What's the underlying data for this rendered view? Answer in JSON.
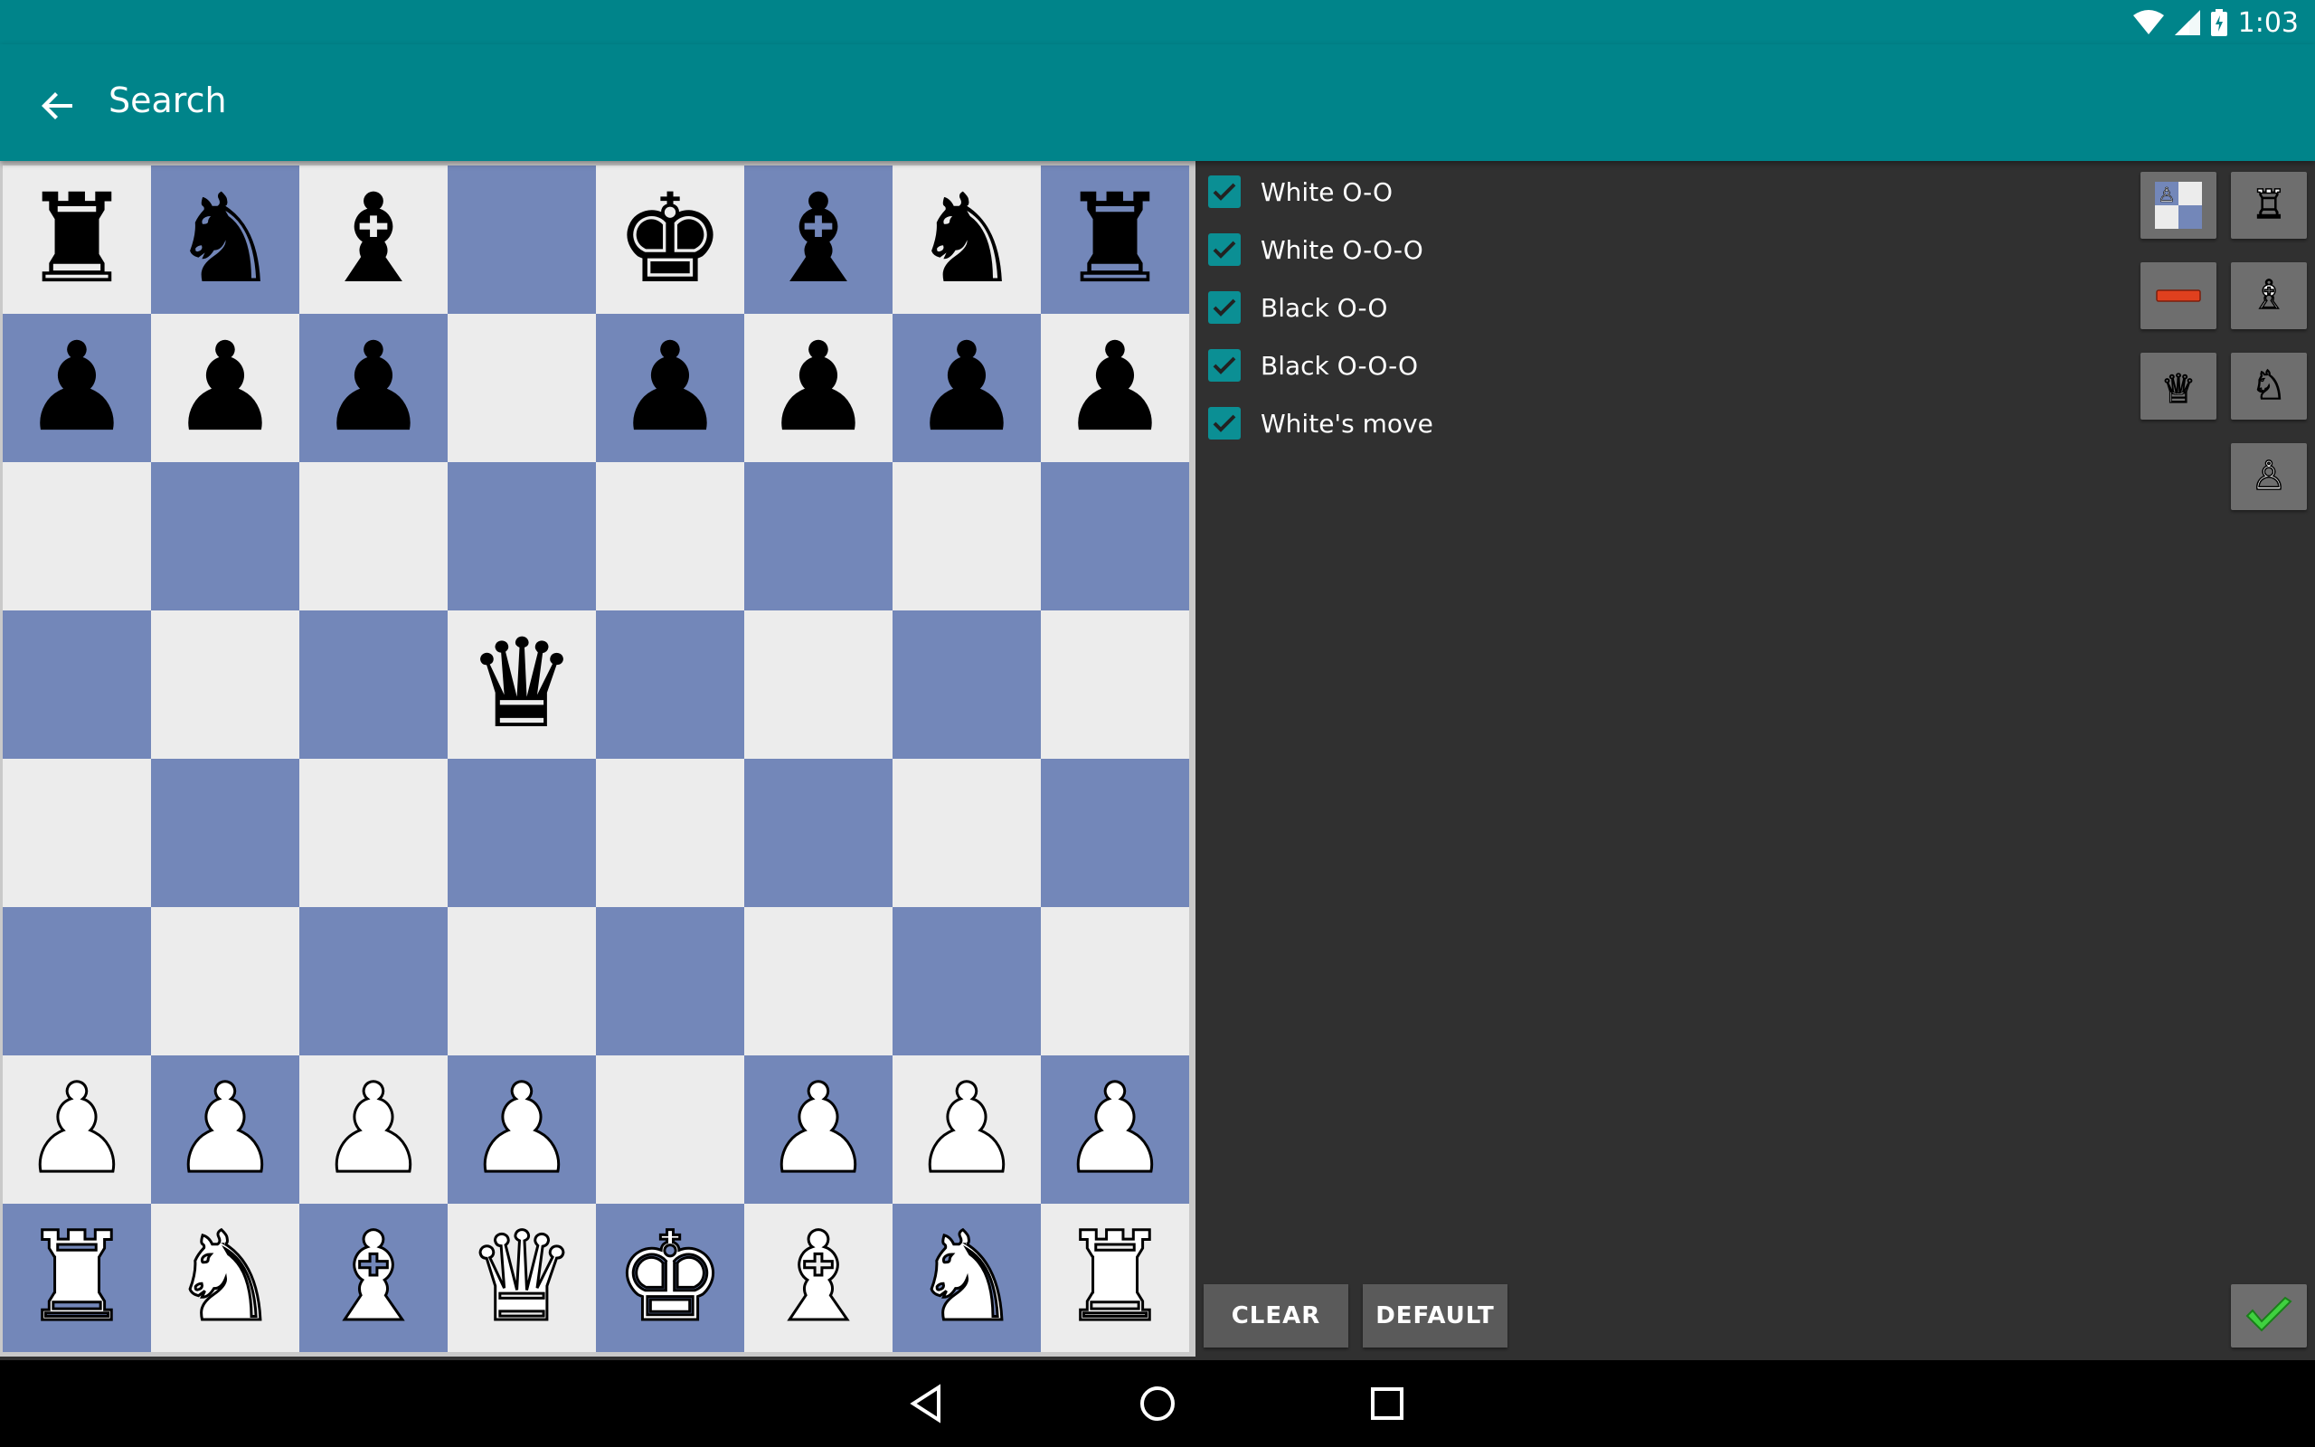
{
  "status_bar": {
    "time": "1:03"
  },
  "app_bar": {
    "title": "Search"
  },
  "board": {
    "rows": [
      [
        "br",
        "bn",
        "bb",
        "",
        "bk",
        "bb",
        "bn",
        "br"
      ],
      [
        "bp",
        "bp",
        "bp",
        "",
        "bp",
        "bp",
        "bp",
        "bp"
      ],
      [
        "",
        "",
        "",
        "",
        "",
        "",
        "",
        ""
      ],
      [
        "",
        "",
        "",
        "bq",
        "",
        "",
        "",
        ""
      ],
      [
        "",
        "",
        "",
        "",
        "",
        "",
        "",
        ""
      ],
      [
        "",
        "",
        "",
        "",
        "",
        "",
        "",
        ""
      ],
      [
        "wp",
        "wp",
        "wp",
        "wp",
        "",
        "wp",
        "wp",
        "wp"
      ],
      [
        "wr",
        "wn",
        "wb",
        "wq",
        "wk",
        "wb",
        "wn",
        "wr"
      ]
    ],
    "light_color": "#ececec",
    "dark_color": "#7387b9"
  },
  "options": [
    {
      "label": "White O-O",
      "checked": true
    },
    {
      "label": "White O-O-O",
      "checked": true
    },
    {
      "label": "Black O-O",
      "checked": true
    },
    {
      "label": "Black O-O-O",
      "checked": true
    },
    {
      "label": "White's move",
      "checked": true
    }
  ],
  "tools": {
    "icons": [
      "flip-board-icon",
      "rook-icon",
      "delete-icon",
      "bishop-icon",
      "color-crown-icon",
      "knight-icon",
      "pawn-icon"
    ]
  },
  "buttons": {
    "clear": "CLEAR",
    "default": "DEFAULT"
  },
  "accent_color": "#00848a"
}
